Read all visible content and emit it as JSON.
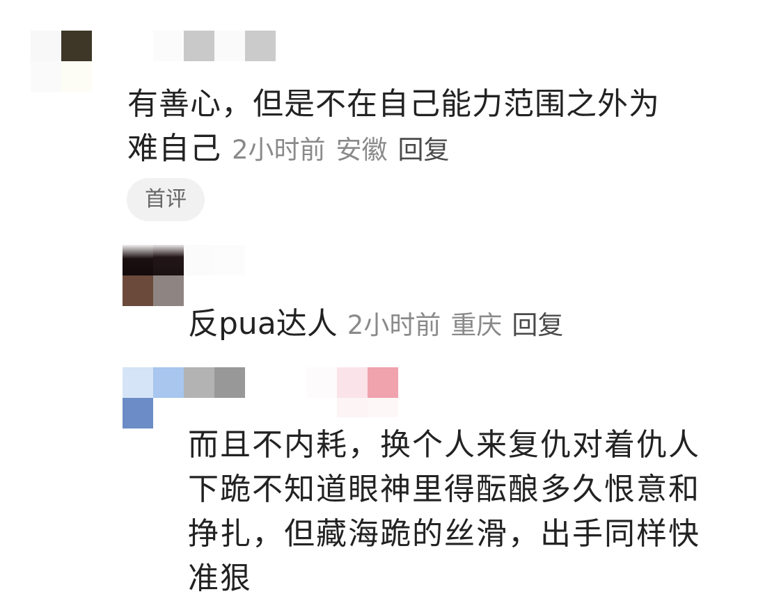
{
  "comments": [
    {
      "text_line1": "有善心，但是不在自己能力范围之外为",
      "text_line2": "难自己",
      "time": "2小时前",
      "location": "安徽",
      "reply_label": "回复",
      "badge": "首评"
    },
    {
      "text": "反pua达人",
      "time": "2小时前",
      "location": "重庆",
      "reply_label": "回复"
    },
    {
      "text_line1": "而且不内耗，换个人来复仇对着仇人",
      "text_line2": "下跪不知道眼神里得酝酿多久恨意和",
      "text_line3": "挣扎，但藏海跪的丝滑，出手同样快",
      "text_line4_partial": "准狠"
    }
  ],
  "colors": {
    "text": "#222222",
    "meta": "#8a8a8a",
    "reply": "#4a4a4a",
    "badge_bg": "#f1f1f1"
  }
}
